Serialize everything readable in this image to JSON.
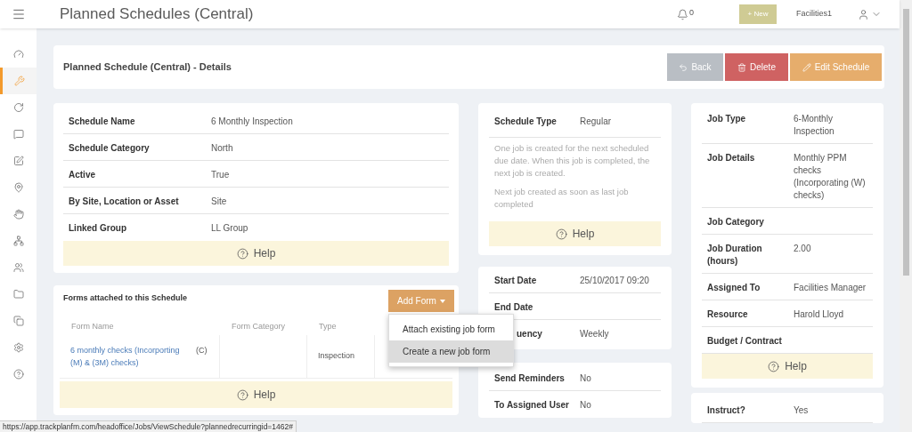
{
  "header": {
    "title": "Planned Schedules (Central)",
    "notifications": "0",
    "new_button": "+ New",
    "user": "Facilities1"
  },
  "sidebar": {
    "items": [
      {
        "selected": false
      },
      {
        "selected": true
      },
      {
        "selected": false
      },
      {
        "selected": false
      },
      {
        "selected": false
      },
      {
        "selected": false
      },
      {
        "selected": false
      },
      {
        "selected": false
      },
      {
        "selected": false
      },
      {
        "selected": false
      },
      {
        "selected": false
      },
      {
        "selected": false
      },
      {
        "selected": false
      }
    ]
  },
  "details_bar": {
    "title": "Planned Schedule (Central) - Details",
    "buttons": [
      {
        "kind": "back",
        "label": "Back"
      },
      {
        "kind": "delete",
        "label": "Delete"
      },
      {
        "kind": "edit",
        "label": "Edit Schedule"
      }
    ]
  },
  "schedule_card": {
    "rows": [
      {
        "label": "Schedule Name",
        "value": "6 Monthly Inspection"
      },
      {
        "label": "Schedule Category",
        "value": "North"
      },
      {
        "label": "Active",
        "value": "True"
      },
      {
        "label": "By Site, Location or Asset",
        "value": "Site"
      },
      {
        "label": "Linked Group",
        "value": "LL Group"
      }
    ],
    "help": "Help"
  },
  "forms_card": {
    "title": "Forms attached to this Schedule",
    "add_button": "Add Form",
    "columns": [
      "Form Name",
      "Form Category",
      "Type"
    ],
    "rows": [
      {
        "form_name": "6 monthly checks (Incorporting (M) & (3M) checks)",
        "badge": "(C)",
        "type": "Inspection"
      }
    ],
    "help": "Help",
    "dropdown": {
      "items": [
        {
          "label": "Attach existing job form",
          "selected": false
        },
        {
          "label": "Create a new job form",
          "selected": true
        }
      ]
    }
  },
  "type_card": {
    "label": "Schedule Type",
    "value": "Regular",
    "notes": [
      "One job is created for the next scheduled due date. When this job is completed, the next job is created.",
      "Next job created as soon as last job completed"
    ],
    "help": "Help"
  },
  "dates_card": {
    "rows": [
      {
        "label": "Start Date",
        "value": "25/10/2017 09:20"
      },
      {
        "label": "End Date"
      },
      {
        "label": "uency",
        "value": "Weekly"
      }
    ]
  },
  "reminders_card": {
    "rows": [
      {
        "label": "Send Reminders",
        "value": "No"
      },
      {
        "label": "To Assigned User",
        "value": "No"
      }
    ]
  },
  "job_card": {
    "rows": [
      {
        "label": "Job Type",
        "value": "6-Monthly Inspection"
      },
      {
        "label": "Job Details",
        "value": "Monthly PPM checks (Incorporating (W) checks)"
      },
      {
        "label": "Job Category"
      },
      {
        "label": "Job Duration (hours)",
        "value": "2.00"
      },
      {
        "label": "Assigned To",
        "value": "Facilities Manager"
      },
      {
        "label": "Resource",
        "value": "Harold Lloyd"
      },
      {
        "label": "Budget / Contract"
      }
    ],
    "help": "Help"
  },
  "instruct_card": {
    "rows": [
      {
        "label": "Instruct?",
        "value": "Yes"
      }
    ]
  },
  "status_bar": {
    "url": "https://app.trackplanfm.com/headoffice/Jobs/ViewSchedule?plannedrecurringid=1462#"
  }
}
